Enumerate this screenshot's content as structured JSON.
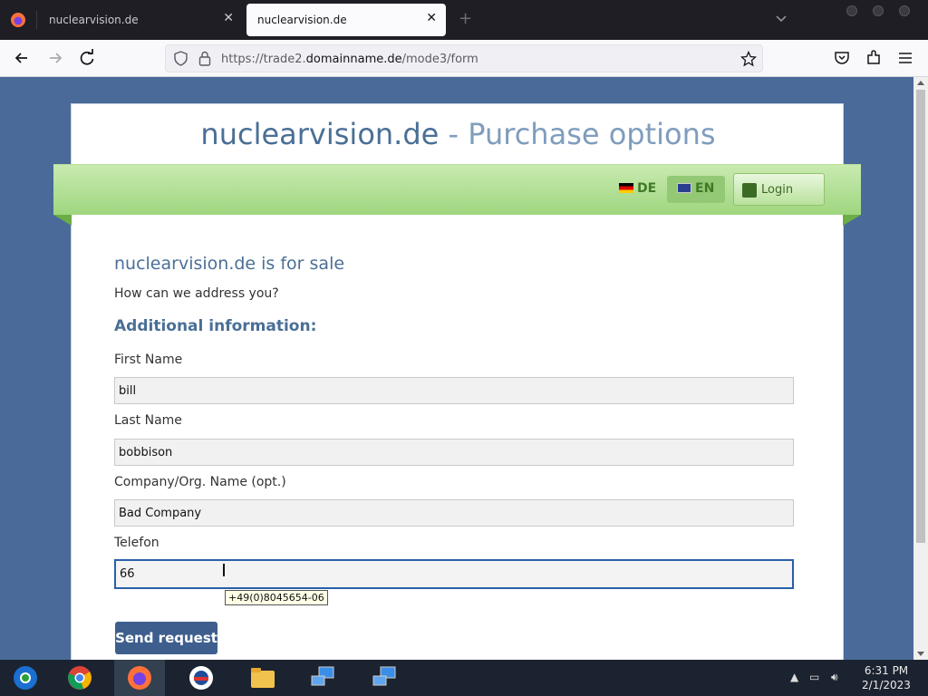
{
  "browser": {
    "tabs": [
      {
        "title": "nuclearvision.de",
        "active": false
      },
      {
        "title": "nuclearvision.de",
        "active": true
      }
    ],
    "url_prefix": "https://trade2.",
    "url_domain": "domainname.de",
    "url_path": "/mode3/form"
  },
  "page": {
    "title_main": "nuclearvision.de",
    "title_sep": " - ",
    "title_accent": "Purchase options",
    "lang_de": "DE",
    "lang_en": "EN",
    "login_label": "Login",
    "heading": "nuclearvision.de is for sale",
    "subheading": "How can we address you?",
    "section": "Additional information:",
    "fields": [
      {
        "label": "First Name",
        "value": "bill"
      },
      {
        "label": "Last Name",
        "value": "bobbison"
      },
      {
        "label": "Company/Org. Name (opt.)",
        "value": "Bad Company"
      },
      {
        "label": "Telefon",
        "value": "66"
      }
    ],
    "phone_tooltip": "+49(0)8045654-06",
    "submit_label": "Send request"
  },
  "taskbar": {
    "time": "6:31 PM",
    "date": "2/1/2023",
    "colors": {
      "accent": "#4a6f96",
      "green": "#9fd67f",
      "button": "#3e5f8e"
    }
  }
}
